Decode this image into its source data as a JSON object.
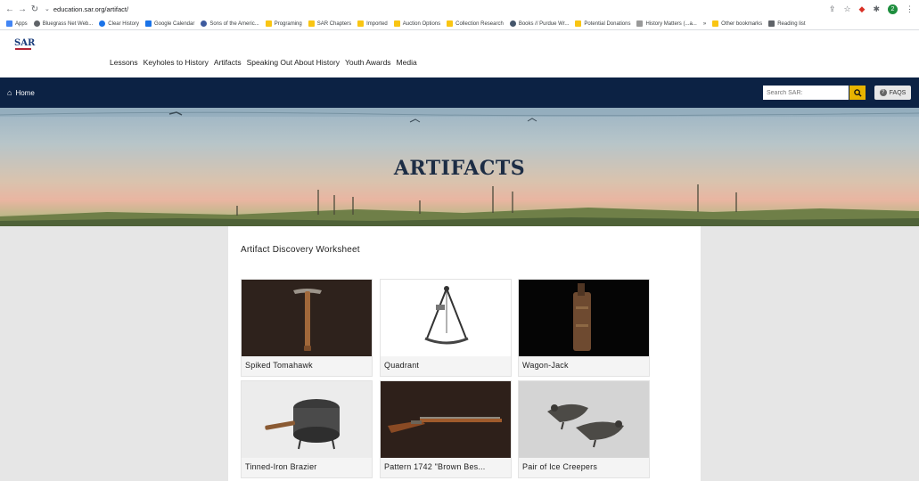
{
  "browser": {
    "url": "education.sar.org/artifact/",
    "bookmarks": [
      "Apps",
      "Bluegrass Net Web...",
      "Clear History",
      "Google Calendar",
      "Sons of the Americ...",
      "Programing",
      "SAR Chapters",
      "Imported",
      "Auction Options",
      "Collection Research",
      "Books // Purdue Wr...",
      "Potential Donations",
      "History Matters (...a...",
      "»",
      "Other bookmarks",
      "Reading list"
    ],
    "profile_initial": "2"
  },
  "site": {
    "logo_text": "SAR",
    "nav": [
      "Lessons",
      "Keyholes to History",
      "Artifacts",
      "Speaking Out About History",
      "Youth Awards",
      "Media"
    ],
    "home_label": "Home",
    "search_placeholder": "Search SAR:",
    "faq_label": "FAQS"
  },
  "hero": {
    "title": "ARTIFACTS"
  },
  "main": {
    "worksheet_label": "Artifact Discovery Worksheet",
    "artifacts": [
      {
        "name": "Spiked Tomahawk"
      },
      {
        "name": "Quadrant"
      },
      {
        "name": "Wagon-Jack"
      },
      {
        "name": "Tinned-Iron Brazier"
      },
      {
        "name": "Pattern 1742 \"Brown Bes..."
      },
      {
        "name": "Pair of Ice Creepers"
      }
    ]
  },
  "colors": {
    "navy": "#0c2244",
    "search_button": "#e8b400",
    "page_background": "#e6e6e6"
  },
  "icons": [
    "back-arrow-icon",
    "forward-arrow-icon",
    "reload-icon",
    "home-icon",
    "search-icon",
    "help-icon",
    "star-icon",
    "share-icon",
    "extension-icon"
  ]
}
